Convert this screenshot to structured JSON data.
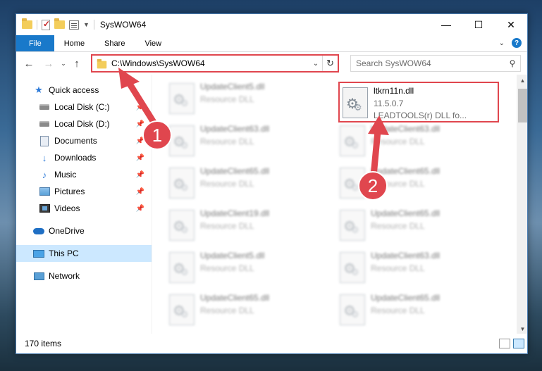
{
  "window": {
    "title": "SysWOW64",
    "controls": {
      "minimize": "—",
      "maximize": "☐",
      "close": "✕"
    }
  },
  "ribbon": {
    "tabs": [
      {
        "label": "File"
      },
      {
        "label": "Home"
      },
      {
        "label": "Share"
      },
      {
        "label": "View"
      }
    ]
  },
  "navigation": {
    "address": "C:\\Windows\\SysWOW64",
    "search_placeholder": "Search SysWOW64"
  },
  "sidebar": {
    "items": [
      {
        "label": "Quick access",
        "icon": "star-icon"
      },
      {
        "label": "Local Disk (C:)",
        "icon": "disk-icon",
        "pinned": true
      },
      {
        "label": "Local Disk (D:)",
        "icon": "disk-icon",
        "pinned": true
      },
      {
        "label": "Documents",
        "icon": "document-icon",
        "pinned": true
      },
      {
        "label": "Downloads",
        "icon": "download-icon",
        "pinned": true
      },
      {
        "label": "Music",
        "icon": "music-icon",
        "pinned": true
      },
      {
        "label": "Pictures",
        "icon": "pictures-icon",
        "pinned": true
      },
      {
        "label": "Videos",
        "icon": "videos-icon",
        "pinned": true
      },
      {
        "label": "OneDrive",
        "icon": "cloud-icon"
      },
      {
        "label": "This PC",
        "icon": "computer-icon",
        "selected": true
      },
      {
        "label": "Network",
        "icon": "network-icon"
      }
    ]
  },
  "files": {
    "left_column": [
      {
        "name": "UpdateClient5.dll",
        "type": "Resource DLL"
      },
      {
        "name": "UpdateClient63.dll",
        "type": "Resource DLL"
      },
      {
        "name": "UpdateClient65.dll",
        "type": "Resource DLL"
      },
      {
        "name": "UpdateClient19.dll",
        "type": "Resource DLL"
      },
      {
        "name": "UpdateClient5.dll",
        "type": "Resource DLL"
      },
      {
        "name": "UpdateClient65.dll",
        "type": "Resource DLL"
      }
    ],
    "right_column": [
      {
        "name": "ltkrn11n.dll",
        "version": "11.5.0.7",
        "type": "LEADTOOLS(r) DLL fo...",
        "highlighted": true
      },
      {
        "name": "UpdateClient63.dll",
        "type": "Resource DLL"
      },
      {
        "name": "UpdateClient65.dll",
        "type": "Resource DLL"
      },
      {
        "name": "UpdateClient65.dll",
        "type": "Resource DLL"
      },
      {
        "name": "UpdateClient63.dll",
        "type": "Resource DLL"
      },
      {
        "name": "UpdateClient65.dll",
        "type": "Resource DLL"
      }
    ]
  },
  "status": {
    "item_count": "170 items"
  },
  "annotations": {
    "badge1": "1",
    "badge2": "2",
    "color": "#e0464e"
  }
}
